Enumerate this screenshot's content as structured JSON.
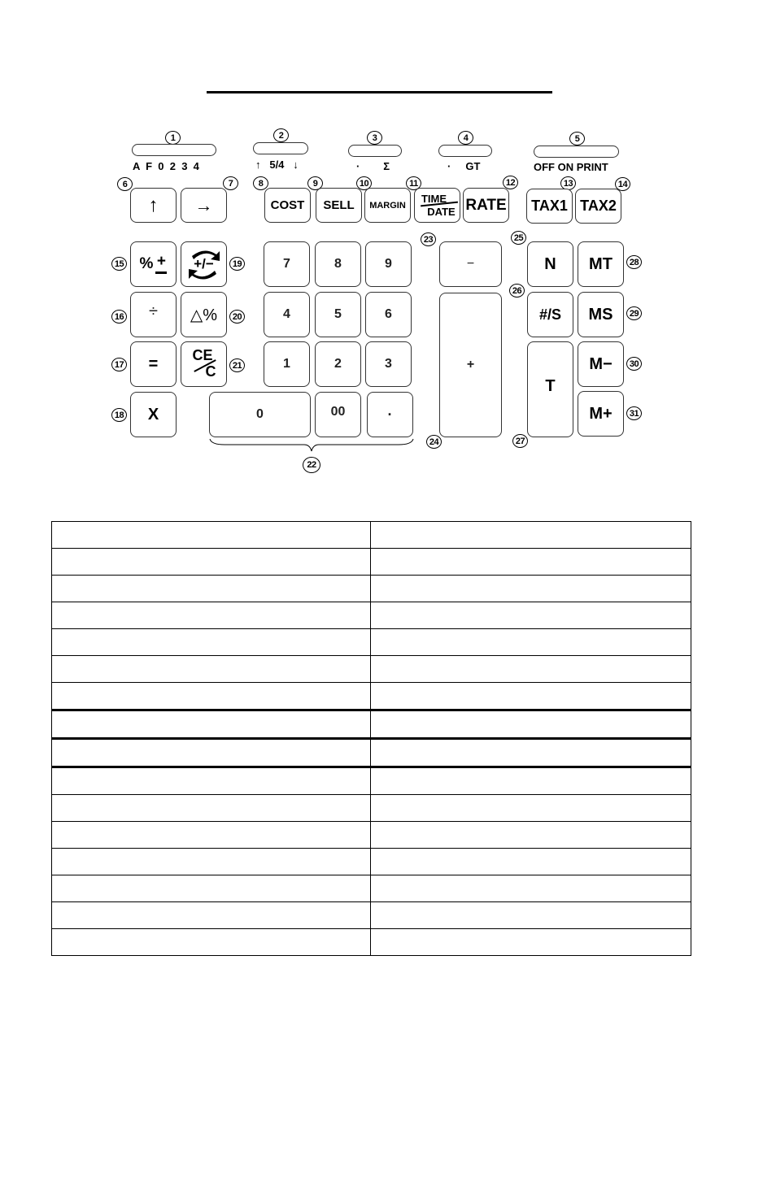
{
  "page": {
    "background": "#ffffff",
    "title_rule": true
  },
  "sliders": [
    {
      "callout": "1",
      "positions": "A  F  0  2  3  4"
    },
    {
      "callout": "2",
      "positions": "↑   5/4   ↓"
    },
    {
      "callout": "3",
      "positions": "·        Σ"
    },
    {
      "callout": "4",
      "positions": "·     GT"
    },
    {
      "callout": "5",
      "positions": "OFF ON PRINT"
    }
  ],
  "keys": {
    "up_arrow": {
      "callout": "6",
      "label": "↑"
    },
    "right_arrow": {
      "callout": "7",
      "label": "→"
    },
    "cost": {
      "callout": "8",
      "label": "COST"
    },
    "sell": {
      "callout": "9",
      "label": "SELL"
    },
    "margin": {
      "callout": "10",
      "label": "MARGIN"
    },
    "time_date": {
      "callout": "11",
      "label_top": "TIME",
      "label_bottom": "DATE"
    },
    "rate": {
      "callout": "12",
      "label": "RATE"
    },
    "tax1": {
      "callout": "13",
      "label": "TAX1"
    },
    "tax2": {
      "callout": "14",
      "label": "TAX2"
    },
    "percent_plusminus": {
      "callout": "15",
      "label_pct": "%",
      "label_plus": "+"
    },
    "divide": {
      "callout": "16",
      "label": "÷"
    },
    "equals": {
      "callout": "17",
      "label": "="
    },
    "multiply": {
      "callout": "18",
      "label": "X"
    },
    "sign_change": {
      "callout": "19",
      "label": "+/−"
    },
    "delta_percent": {
      "callout": "20",
      "label": "△%"
    },
    "clear_entry": {
      "callout": "21",
      "label_top": "CE",
      "label_bottom": "C"
    },
    "numeric_group": {
      "callout": "22"
    },
    "minus": {
      "callout": "23",
      "label": "−"
    },
    "plus": {
      "callout": "24",
      "label": "+"
    },
    "non_add": {
      "callout": "25",
      "label": "N"
    },
    "subtotal": {
      "callout": "26",
      "label": "#/S"
    },
    "total": {
      "callout": "27",
      "label": "T"
    },
    "memory_total": {
      "callout": "28",
      "label": "MT"
    },
    "memory_subtotal": {
      "callout": "29",
      "label": "MS"
    },
    "memory_minus": {
      "callout": "30",
      "label": "M−"
    },
    "memory_plus": {
      "callout": "31",
      "label": "M+"
    }
  },
  "digits": [
    "7",
    "8",
    "9",
    "4",
    "5",
    "6",
    "1",
    "2",
    "3",
    "0",
    "00",
    "·"
  ],
  "table": {
    "columns": 2,
    "rows": [
      [
        "",
        ""
      ],
      [
        "",
        ""
      ],
      [
        "",
        ""
      ],
      [
        "",
        ""
      ],
      [
        "",
        ""
      ],
      [
        "",
        ""
      ],
      [
        "",
        ""
      ],
      [
        "",
        ""
      ],
      [
        "",
        ""
      ],
      [
        "",
        ""
      ],
      [
        "",
        ""
      ],
      [
        "",
        ""
      ],
      [
        "",
        ""
      ],
      [
        "",
        ""
      ],
      [
        "",
        ""
      ],
      [
        "",
        ""
      ]
    ]
  }
}
